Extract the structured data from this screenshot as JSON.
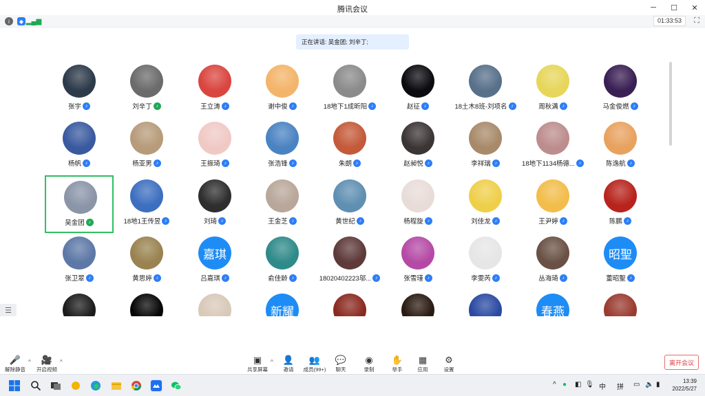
{
  "window": {
    "title": "腾讯会议"
  },
  "meeting": {
    "timer": "01:33:53",
    "speaking_text": "正在讲话: 吴金团; 刘辛丁;"
  },
  "participants": [
    {
      "name": "张宇",
      "bg": "#2d3a4a"
    },
    {
      "name": "刘辛丁",
      "bg": "#6b6b6b",
      "mic": "active"
    },
    {
      "name": "王立涛",
      "bg": "#d9463f"
    },
    {
      "name": "谢中俊",
      "bg": "#f4b46a"
    },
    {
      "name": "18地下1成昕阳",
      "bg": "#8b8b8b"
    },
    {
      "name": "赵征",
      "bg": "#0b0b10"
    },
    {
      "name": "18土木8班-刘项名",
      "bg": "#58708a"
    },
    {
      "name": "周秋满",
      "bg": "#e7d65a"
    },
    {
      "name": "马金俊燃",
      "bg": "#3a1f54"
    },
    {
      "name": "杨帆",
      "bg": "#3a5aa0"
    },
    {
      "name": "杨亚男",
      "bg": "#b79b7a"
    },
    {
      "name": "王振琦",
      "bg": "#f0c9c5"
    },
    {
      "name": "张浩锋",
      "bg": "#4a83c2"
    },
    {
      "name": "朱朗",
      "bg": "#c45a3a"
    },
    {
      "name": "赵昶悦",
      "bg": "#3c3535"
    },
    {
      "name": "李祥瑞",
      "bg": "#a88a6a"
    },
    {
      "name": "18地下1134杨德...",
      "bg": "#bd8d8d"
    },
    {
      "name": "陈逸航",
      "bg": "#e8a25f"
    },
    {
      "name": "吴金团",
      "bg": "#8a95a8",
      "mic": "active",
      "selected": true
    },
    {
      "name": "18地1王传昱",
      "bg": "#3d6fc0"
    },
    {
      "name": "刘琦",
      "bg": "#2e2e2e"
    },
    {
      "name": "王金芝",
      "bg": "#b8a79a"
    },
    {
      "name": "黄世纪",
      "bg": "#5f8fb2"
    },
    {
      "name": "杨程旋",
      "bg": "#e8dcd8"
    },
    {
      "name": "刘佳龙",
      "bg": "#efcf4a"
    },
    {
      "name": "王尹婷",
      "bg": "#f2bd4a"
    },
    {
      "name": "陈鹏",
      "bg": "#b8241d"
    },
    {
      "name": "张卫翠",
      "bg": "#5d78a6"
    },
    {
      "name": "黄思婷",
      "bg": "#9a8350"
    },
    {
      "name": "吕嘉琪",
      "avatar_text": "嘉琪"
    },
    {
      "name": "俞佳龄",
      "bg": "#2f8a8a"
    },
    {
      "name": "18020402223邬...",
      "bg": "#5e3a3a"
    },
    {
      "name": "张雪瑾",
      "bg": "#b54aa5"
    },
    {
      "name": "李雯芮",
      "bg": "#e6e6e6"
    },
    {
      "name": "丛海琦",
      "bg": "#6a5145"
    },
    {
      "name": "董昭聖",
      "avatar_text": "昭聖"
    },
    {
      "name": "",
      "bg": "#1c1c1c",
      "partial": true
    },
    {
      "name": "",
      "bg": "#060606",
      "partial": true
    },
    {
      "name": "",
      "bg": "#d8c9b8",
      "partial": true
    },
    {
      "name": "",
      "avatar_text": "新耀",
      "partial": true
    },
    {
      "name": "",
      "bg": "#8a2a20",
      "partial": true
    },
    {
      "name": "",
      "bg": "#2a1b12",
      "partial": true
    },
    {
      "name": "",
      "bg": "#2a4aa2",
      "partial": true
    },
    {
      "name": "",
      "avatar_text": "春燕",
      "partial": true
    },
    {
      "name": "",
      "bg": "#9a3b30",
      "partial": true
    }
  ],
  "toolbar": {
    "left": [
      {
        "label": "解除静音",
        "icon": "🎤"
      },
      {
        "label": "开启视频",
        "icon": "🎥"
      }
    ],
    "center": [
      {
        "label": "共享屏幕",
        "icon": "▣"
      },
      {
        "label": "邀请",
        "icon": "👤"
      },
      {
        "label": "成员(99+)",
        "icon": "👥"
      },
      {
        "label": "聊天",
        "icon": "💬"
      },
      {
        "label": "录制",
        "icon": "◉"
      },
      {
        "label": "举手",
        "icon": "✋"
      },
      {
        "label": "应用",
        "icon": "▦"
      },
      {
        "label": "设置",
        "icon": "⚙"
      }
    ],
    "leave_label": "离开会议"
  },
  "taskbar": {
    "tray_ime": "中",
    "tray_ime2": "拼",
    "time": "13:39",
    "date": "2022/5/27"
  },
  "colors": {
    "accent": "#2d7ef7",
    "speaking_bg": "#e4efff",
    "leave": "#e23d3d",
    "selected_border": "#2fbe62"
  }
}
